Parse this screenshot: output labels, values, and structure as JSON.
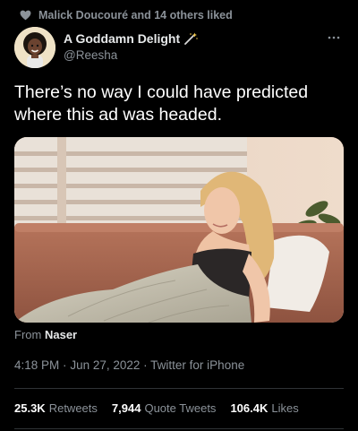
{
  "social_context": {
    "icon": "heart-icon",
    "text": "Malick Doucouré and 14 others liked"
  },
  "author": {
    "display_name": "A Goddamn Delight",
    "badge_icon": "magic-wand-icon",
    "handle": "@Reesha"
  },
  "more_icon": "more-dots-icon",
  "tweet": {
    "text": "There’s no way I could have predicted where this ad was headed."
  },
  "media": {
    "description_icon": "video-thumbnail"
  },
  "source": {
    "prefix": "From",
    "name": "Naser"
  },
  "meta": {
    "time": "4:18 PM",
    "separator1": "·",
    "date": "Jun 27, 2022",
    "separator2": "·",
    "client": "Twitter for iPhone"
  },
  "stats": {
    "retweets_count": "25.3K",
    "retweets_label": "Retweets",
    "quotes_count": "7,944",
    "quotes_label": "Quote Tweets",
    "likes_count": "106.4K",
    "likes_label": "Likes"
  },
  "colors": {
    "background": "#000000",
    "primary_text": "#e7e9ea",
    "secondary_text": "#8b9299",
    "divider": "#2f3336"
  }
}
